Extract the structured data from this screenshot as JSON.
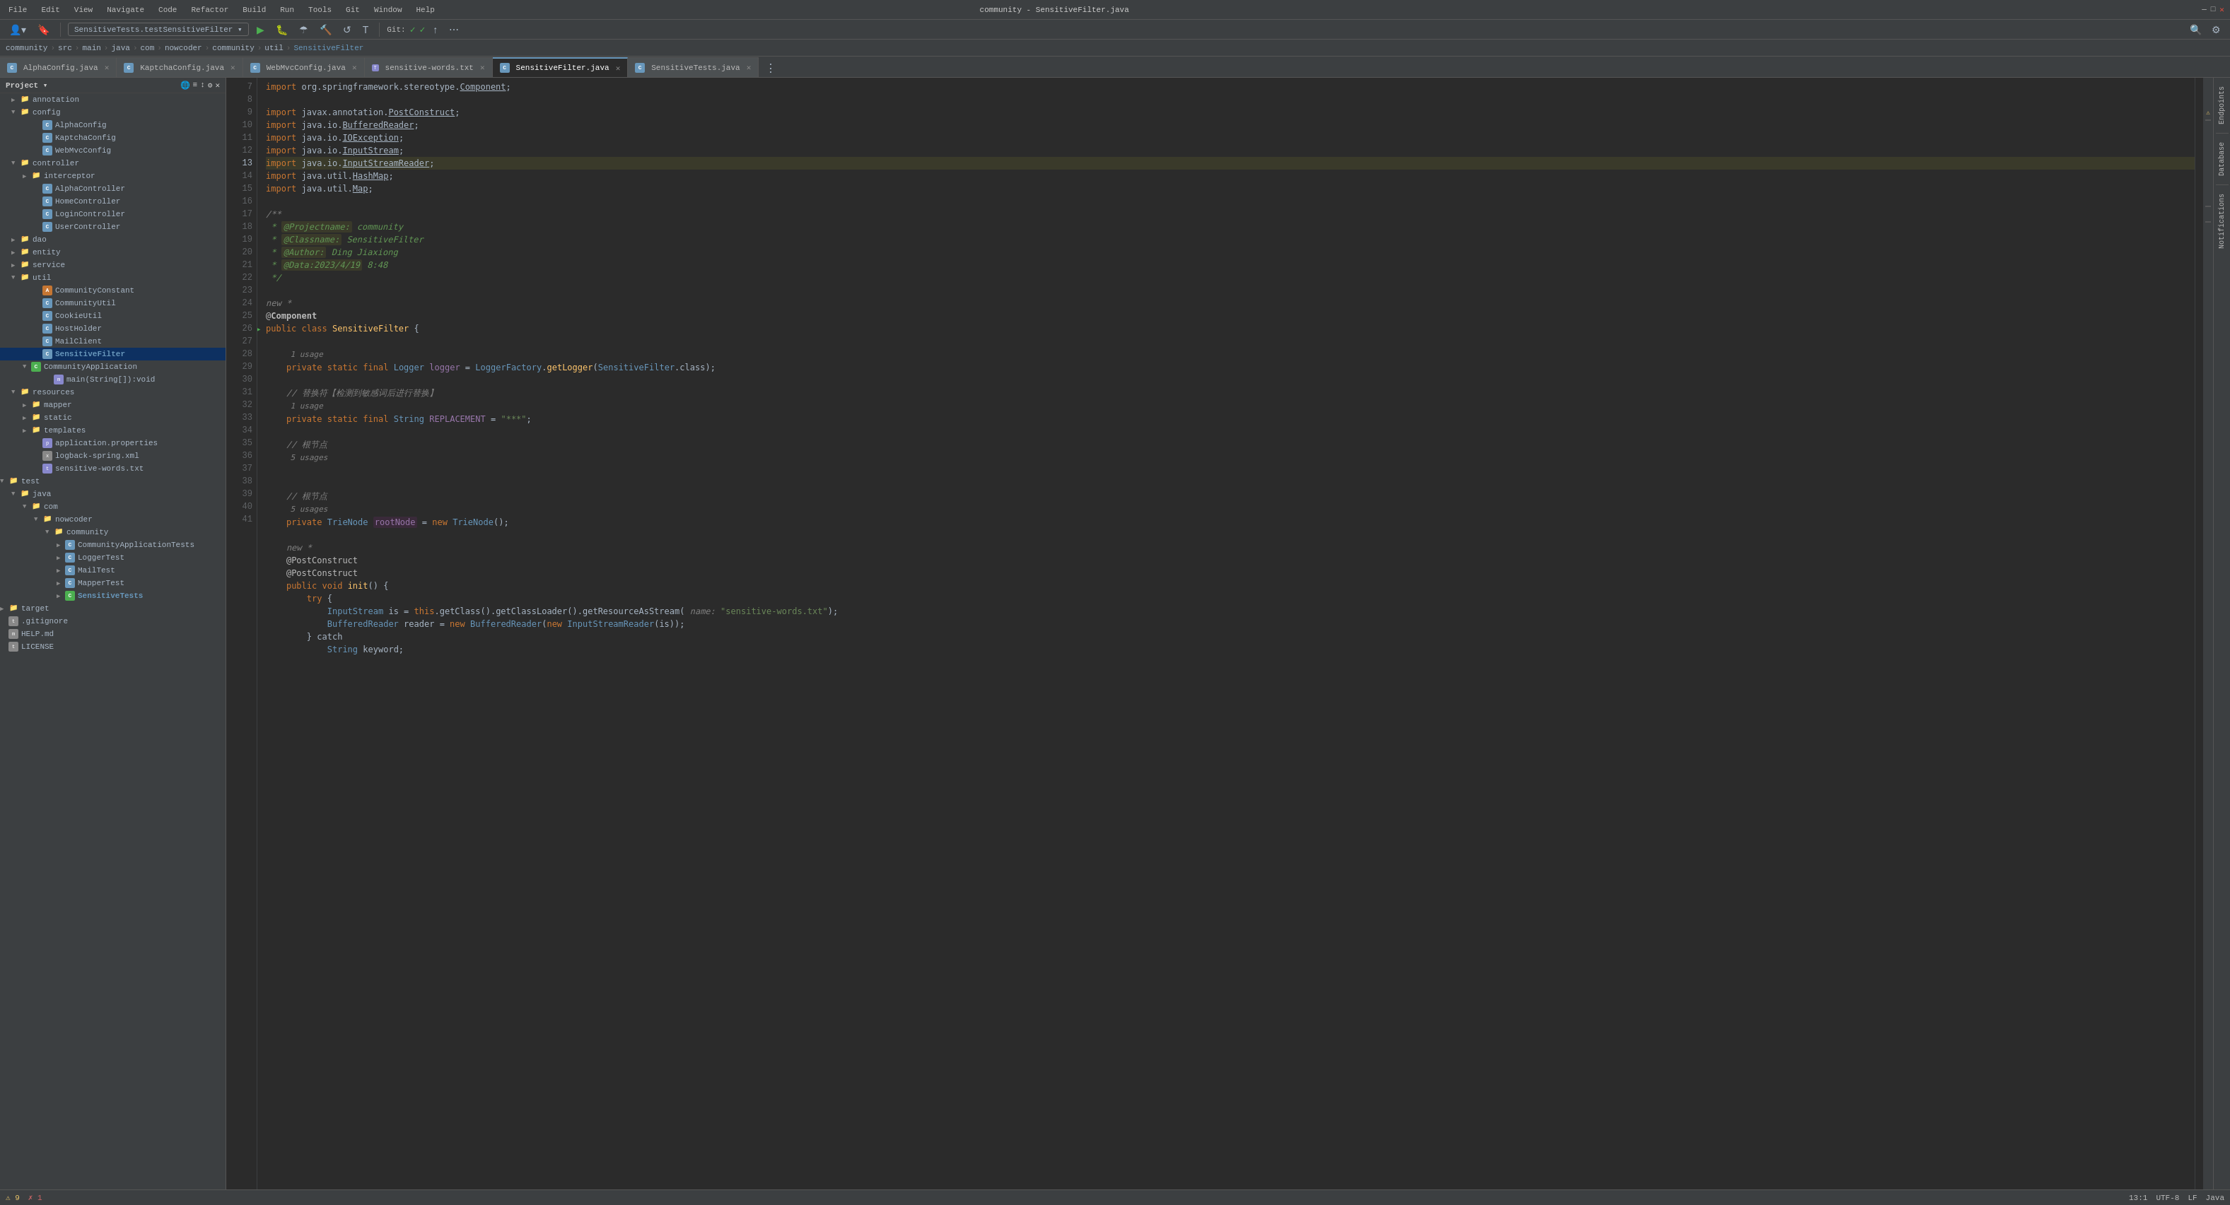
{
  "titleBar": {
    "menus": [
      "File",
      "Edit",
      "View",
      "Navigate",
      "Code",
      "Refactor",
      "Build",
      "Run",
      "Tools",
      "Git",
      "Window",
      "Help"
    ],
    "title": "community - SensitiveFilter.java"
  },
  "breadcrumb": {
    "items": [
      "community",
      "src",
      "main",
      "java",
      "com",
      "nowcoder",
      "community",
      "util"
    ],
    "current": "SensitiveFilter"
  },
  "tabs": [
    {
      "label": "AlphaConfig.java",
      "type": "java",
      "active": false,
      "modified": false
    },
    {
      "label": "KaptchaConfig.java",
      "type": "java",
      "active": false,
      "modified": false
    },
    {
      "label": "WebMvcConfig.java",
      "type": "java",
      "active": false,
      "modified": false
    },
    {
      "label": "sensitive-words.txt",
      "type": "txt",
      "active": false,
      "modified": false
    },
    {
      "label": "SensitiveFilter.java",
      "type": "java",
      "active": true,
      "modified": false
    },
    {
      "label": "SensitiveTests.java",
      "type": "java",
      "active": false,
      "modified": false
    }
  ],
  "runBar": {
    "config": "SensitiveTests.testSensitiveFilter",
    "gitStatus": "Git:"
  },
  "sidebar": {
    "title": "Project",
    "items": [
      {
        "label": "annotation",
        "type": "folder",
        "depth": 1,
        "expanded": false
      },
      {
        "label": "config",
        "type": "folder",
        "depth": 1,
        "expanded": true
      },
      {
        "label": "AlphaConfig",
        "type": "java-c",
        "depth": 3
      },
      {
        "label": "KaptchaConfig",
        "type": "java-c",
        "depth": 3
      },
      {
        "label": "WebMvcConfig",
        "type": "java-c",
        "depth": 3
      },
      {
        "label": "controller",
        "type": "folder",
        "depth": 1,
        "expanded": true
      },
      {
        "label": "interceptor",
        "type": "folder",
        "depth": 2,
        "expanded": false
      },
      {
        "label": "AlphaController",
        "type": "java-c",
        "depth": 3
      },
      {
        "label": "HomeController",
        "type": "java-c",
        "depth": 3
      },
      {
        "label": "LoginController",
        "type": "java-c",
        "depth": 3
      },
      {
        "label": "UserController",
        "type": "java-c",
        "depth": 3
      },
      {
        "label": "dao",
        "type": "folder",
        "depth": 1,
        "expanded": false
      },
      {
        "label": "entity",
        "type": "folder",
        "depth": 1,
        "expanded": false
      },
      {
        "label": "service",
        "type": "folder",
        "depth": 1,
        "expanded": false
      },
      {
        "label": "util",
        "type": "folder",
        "depth": 1,
        "expanded": true
      },
      {
        "label": "CommunityConstant",
        "type": "java-a",
        "depth": 3
      },
      {
        "label": "CommunityUtil",
        "type": "java-c",
        "depth": 3
      },
      {
        "label": "CookieUtil",
        "type": "java-c",
        "depth": 3
      },
      {
        "label": "HostHolder",
        "type": "java-c",
        "depth": 3
      },
      {
        "label": "MailClient",
        "type": "java-c",
        "depth": 3
      },
      {
        "label": "SensitiveFilter",
        "type": "java-c",
        "depth": 3,
        "selected": true
      },
      {
        "label": "CommunityApplication",
        "type": "java-c-green",
        "depth": 2
      },
      {
        "label": "main(String[]):void",
        "type": "method",
        "depth": 3
      },
      {
        "label": "resources",
        "type": "folder",
        "depth": 1,
        "expanded": true
      },
      {
        "label": "mapper",
        "type": "folder",
        "depth": 2,
        "expanded": false
      },
      {
        "label": "static",
        "type": "folder",
        "depth": 2,
        "expanded": false
      },
      {
        "label": "templates",
        "type": "folder",
        "depth": 2,
        "expanded": false
      },
      {
        "label": "application.properties",
        "type": "prop",
        "depth": 2
      },
      {
        "label": "logback-spring.xml",
        "type": "xml",
        "depth": 2
      },
      {
        "label": "sensitive-words.txt",
        "type": "txt-file",
        "depth": 2
      },
      {
        "label": "test",
        "type": "folder",
        "depth": 0,
        "expanded": true
      },
      {
        "label": "java",
        "type": "folder",
        "depth": 1,
        "expanded": true
      },
      {
        "label": "com",
        "type": "folder",
        "depth": 2,
        "expanded": true
      },
      {
        "label": "nowcoder",
        "type": "folder",
        "depth": 3,
        "expanded": true
      },
      {
        "label": "community",
        "type": "folder",
        "depth": 4,
        "expanded": true
      },
      {
        "label": "CommunityApplicationTests",
        "type": "java-c",
        "depth": 5
      },
      {
        "label": "LoggerTest",
        "type": "java-c",
        "depth": 5
      },
      {
        "label": "MailTest",
        "type": "java-c",
        "depth": 5
      },
      {
        "label": "MapperTest",
        "type": "java-c",
        "depth": 5
      },
      {
        "label": "SensitiveTests",
        "type": "java-c",
        "depth": 5,
        "highlight": true
      },
      {
        "label": "target",
        "type": "folder",
        "depth": 0,
        "expanded": false
      },
      {
        "label": ".gitignore",
        "type": "txt-file",
        "depth": 0
      },
      {
        "label": "HELP.md",
        "type": "txt-file",
        "depth": 0
      },
      {
        "label": "LICENSE",
        "type": "txt-file",
        "depth": 0
      }
    ]
  },
  "codeLines": [
    {
      "num": 7,
      "content": "import org.springframework.stereotype.Component;"
    },
    {
      "num": 8,
      "content": ""
    },
    {
      "num": 9,
      "content": "import javax.annotation.PostConstruct;"
    },
    {
      "num": 10,
      "content": "import java.io.BufferedReader;"
    },
    {
      "num": 11,
      "content": "import java.io.IOException;"
    },
    {
      "num": 12,
      "content": "import java.io.InputStream;"
    },
    {
      "num": 13,
      "content": "import java.io.InputStreamReader;",
      "highlighted": true
    },
    {
      "num": 14,
      "content": "import java.util.HashMap;"
    },
    {
      "num": 15,
      "content": "import java.util.Map;"
    },
    {
      "num": 16,
      "content": ""
    },
    {
      "num": 17,
      "content": "/**"
    },
    {
      "num": 18,
      "content": " * @Projectname: community"
    },
    {
      "num": 19,
      "content": " * @Classname: SensitiveFilter"
    },
    {
      "num": 20,
      "content": " * @Author: Ding Jiaxiong"
    },
    {
      "num": 21,
      "content": " * @Data:2023/4/19 8:48"
    },
    {
      "num": 22,
      "content": " */"
    },
    {
      "num": 23,
      "content": ""
    },
    {
      "num": 24,
      "content": "new *",
      "hint": true
    },
    {
      "num": null,
      "content": "@Component",
      "annotation": true
    },
    {
      "num": 25,
      "content": "public class SensitiveFilter {"
    },
    {
      "num": 26,
      "content": ""
    },
    {
      "num": null,
      "content": "    1 usage",
      "usage": true
    },
    {
      "num": 27,
      "content": "    private static final Logger logger = LoggerFactory.getLogger(SensitiveFilter.class);"
    },
    {
      "num": 28,
      "content": ""
    },
    {
      "num": null,
      "content": "    // 替换符【检测到敏感词后进行替换】",
      "comment2": true
    },
    {
      "num": null,
      "content": "    1 usage",
      "usage": true
    },
    {
      "num": 29,
      "content": "    private static final String REPLACEMENT = \"***\";"
    },
    {
      "num": 30,
      "content": ""
    },
    {
      "num": null,
      "content": "    // 根节点",
      "comment2": true
    },
    {
      "num": null,
      "content": "    5 usages",
      "usage": true
    },
    {
      "num": 31,
      "content": ""
    },
    {
      "num": 32,
      "content": ""
    },
    {
      "num": null,
      "content": "    // 根节点",
      "comment2": true
    },
    {
      "num": null,
      "content": "    5 usages",
      "usage": true
    },
    {
      "num": 33,
      "content": "    private TrieNode rootNode = new TrieNode();"
    },
    {
      "num": 34,
      "content": ""
    },
    {
      "num": null,
      "content": "    new *",
      "hint": true
    },
    {
      "num": null,
      "content": "    @PostConstruct",
      "annotation": true
    },
    {
      "num": 35,
      "content": "    @PostConstruct"
    },
    {
      "num": 36,
      "content": "    public void init() {"
    },
    {
      "num": 37,
      "content": "        try {"
    },
    {
      "num": 38,
      "content": "            InputStream is = this.getClass().getClassLoader().getResourceAsStream( name: \"sensitive-words.txt\");"
    },
    {
      "num": 39,
      "content": "            BufferedReader reader = new BufferedReader(new InputStreamReader(is));"
    },
    {
      "num": 40,
      "content": "        } catch"
    },
    {
      "num": 41,
      "content": "            String keyword;"
    }
  ],
  "statusBar": {
    "warnings": "⚠ 9",
    "errors": "✗ 1",
    "lineCol": "13:1",
    "encoding": "UTF-8",
    "lineEnding": "LF",
    "lang": "Java"
  }
}
